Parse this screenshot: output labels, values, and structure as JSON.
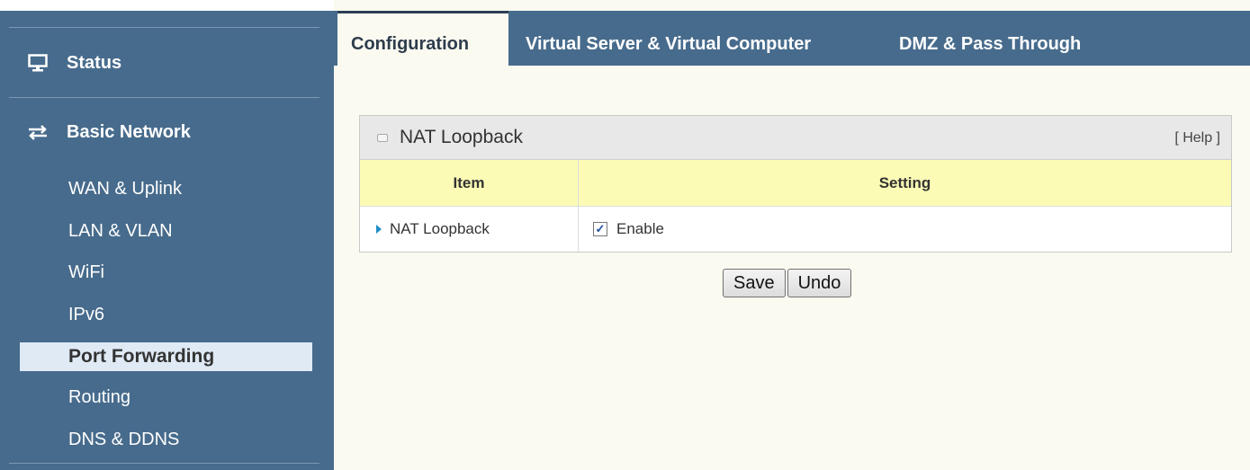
{
  "sidebar": {
    "status_label": "Status",
    "status_icon": "monitor-icon",
    "basic_network_label": "Basic Network",
    "basic_network_icon": "swap-arrows-icon",
    "items": [
      {
        "label": "WAN & Uplink"
      },
      {
        "label": "LAN & VLAN"
      },
      {
        "label": "WiFi"
      },
      {
        "label": "IPv6"
      },
      {
        "label": "Port Forwarding",
        "active": true
      },
      {
        "label": "Routing"
      },
      {
        "label": "DNS & DDNS"
      }
    ]
  },
  "tabs": [
    {
      "label": "Configuration",
      "active": true
    },
    {
      "label": "Virtual Server & Virtual Computer"
    },
    {
      "label": "DMZ & Pass Through"
    }
  ],
  "panel": {
    "title": "NAT Loopback",
    "help": "[ Help ]",
    "headers": {
      "item": "Item",
      "setting": "Setting"
    },
    "rows": [
      {
        "item": "NAT Loopback",
        "setting_label": "Enable",
        "checked": true
      }
    ]
  },
  "buttons": {
    "save": "Save",
    "undo": "Undo"
  },
  "colors": {
    "nav_bg": "#476b8c",
    "content_bg": "#fbfaf0",
    "table_header_bg": "#fbfbb6",
    "active_item_bg": "#dfeaf5"
  }
}
